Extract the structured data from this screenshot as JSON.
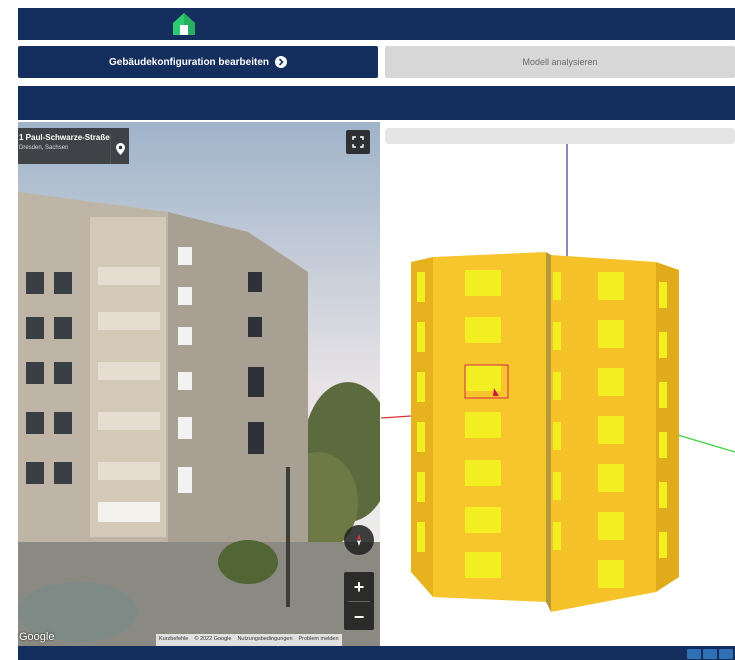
{
  "header": {
    "logo_icon": "house-logo-icon"
  },
  "actions": {
    "edit_label": "Gebäudekonfiguration bearbeiten",
    "analyze_label": "Modell analysieren"
  },
  "streetview": {
    "address_title": "1 Paul-Schwarze-Straße",
    "address_subtitle": "Dresden, Sachsen",
    "zoom_in": "+",
    "zoom_out": "−",
    "google_label": "Google",
    "attribution": [
      "Kurzbefehle",
      "© 2022 Google",
      "Nutzungsbedingungen",
      "Problem melden"
    ]
  },
  "colors": {
    "brand_navy": "#142f5e",
    "button_disabled": "#d7d7d7",
    "model_yellow": "#f5c22a",
    "window_yellow": "#f2ee22"
  }
}
